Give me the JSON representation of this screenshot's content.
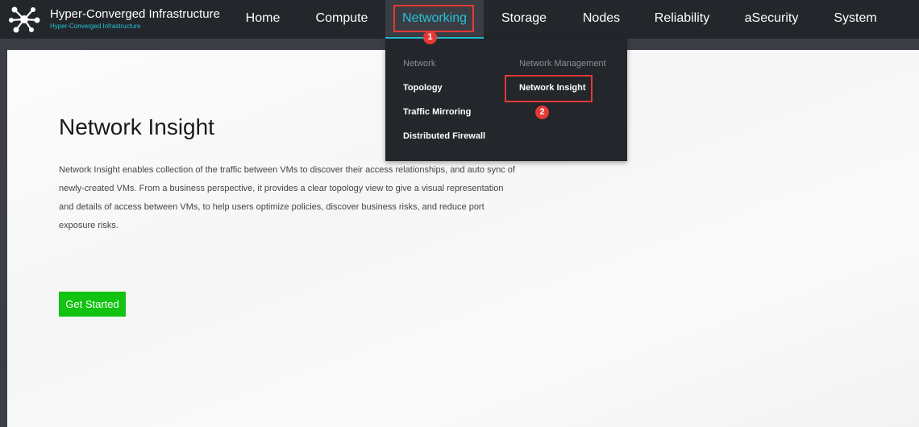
{
  "brand": {
    "title": "Hyper-Converged Infrastructure",
    "subtitle": "Hyper-Converged Infrastructure",
    "logo_icon": "network-nodes-icon"
  },
  "nav": {
    "items": [
      {
        "label": "Home"
      },
      {
        "label": "Compute"
      },
      {
        "label": "Networking"
      },
      {
        "label": "Storage"
      },
      {
        "label": "Nodes"
      },
      {
        "label": "Reliability"
      },
      {
        "label": "aSecurity"
      },
      {
        "label": "System"
      }
    ],
    "active": "Networking"
  },
  "dropdown": {
    "network": {
      "header": "Network",
      "items": [
        "Topology",
        "Traffic Mirroring",
        "Distributed Firewall"
      ]
    },
    "network_management": {
      "header": "Network Management",
      "items": [
        "Network Insight"
      ]
    }
  },
  "annotations": {
    "step1": "1",
    "step2": "2"
  },
  "main": {
    "title": "Network Insight",
    "description": "Network Insight enables collection of the traffic between VMs to discover their access relationships, and auto sync of newly-created VMs. From a business perspective, it provides a clear topology view to give a visual representation and details of access between VMs, to help users optimize policies, discover business risks, and reduce port exposure risks.",
    "cta_label": "Get Started"
  },
  "colors": {
    "accent": "#22c3d6",
    "highlight": "#e53935",
    "cta": "#12c312",
    "topbar": "#23262b"
  }
}
